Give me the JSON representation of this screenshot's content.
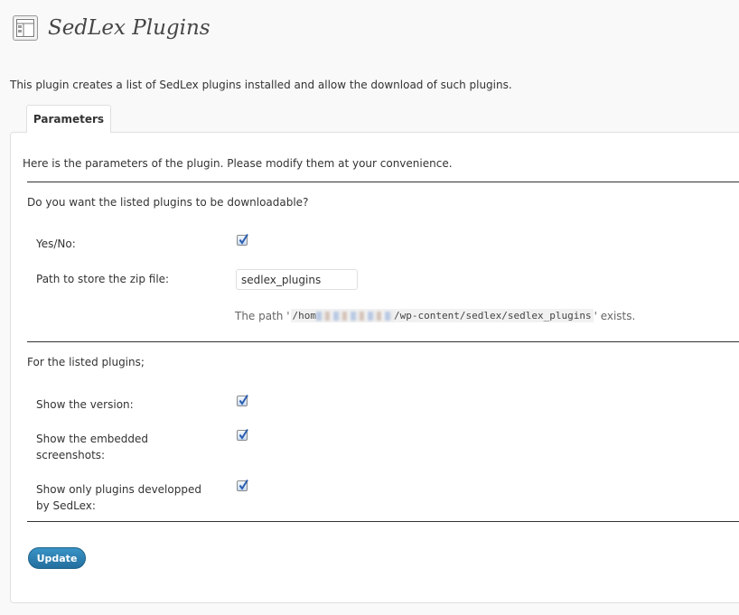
{
  "header": {
    "title": "SedLex Plugins",
    "icon": "settings-page-icon"
  },
  "description": "This plugin creates a list of SedLex plugins installed and allow the download of such plugins.",
  "tabs": [
    {
      "label": "Parameters",
      "active": true
    }
  ],
  "panel": {
    "intro": "Here is the parameters of the plugin. Please modify them at your convenience.",
    "download_section": {
      "heading": "Do you want the listed plugins to be downloadable?",
      "yes_no": {
        "label": "Yes/No:",
        "checked": true
      },
      "path_field": {
        "label": "Path to store the zip file:",
        "value": "sedlex_plugins"
      },
      "path_note": {
        "prefix": "The path '",
        "path_start": "/hom",
        "path_end": "/wp-content/sedlex/sedlex_plugins",
        "suffix": "' exists."
      }
    },
    "listing_section": {
      "heading": "For the listed plugins;",
      "options": [
        {
          "label": "Show the version:",
          "checked": true
        },
        {
          "label": "Show the embedded screenshots:",
          "checked": true
        },
        {
          "label": "Show only plugins developped by SedLex:",
          "checked": true
        }
      ]
    },
    "update_label": "Update"
  },
  "colors": {
    "accent": "#21759b",
    "checkbox_check": "#2a5db0",
    "rule": "#333333"
  }
}
